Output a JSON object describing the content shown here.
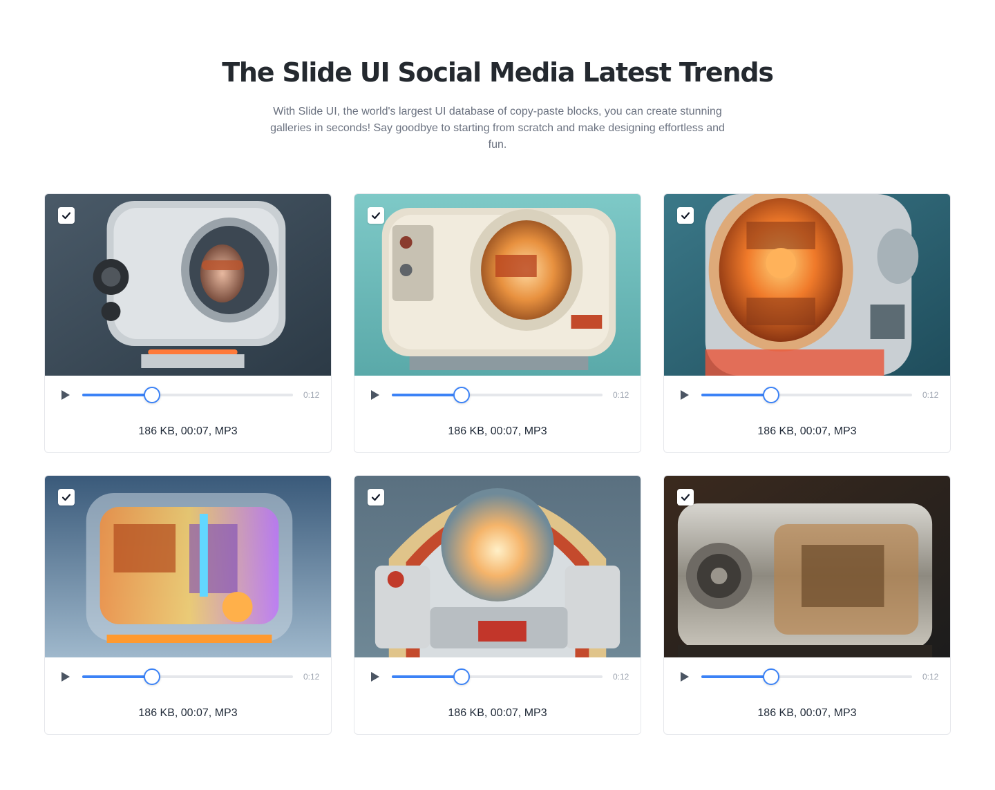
{
  "header": {
    "title": "The Slide UI Social Media Latest Trends",
    "description": "With Slide UI, the world's largest UI database of copy-paste blocks, you can create stunning galleries in seconds! Say goodbye to starting from scratch and make designing effortless and fun."
  },
  "colors": {
    "accent": "#3b82f6",
    "track": "#e5e7eb"
  },
  "cards": [
    {
      "meta": "186 KB, 00:07, MP3",
      "time": "0:12",
      "progress_pct": 33,
      "checked": true,
      "image": "retro-tv-with-face"
    },
    {
      "meta": "186 KB, 00:07, MP3",
      "time": "0:12",
      "progress_pct": 33,
      "checked": true,
      "image": "cream-retro-device"
    },
    {
      "meta": "186 KB, 00:07, MP3",
      "time": "0:12",
      "progress_pct": 33,
      "checked": true,
      "image": "orange-glass-machine"
    },
    {
      "meta": "186 KB, 00:07, MP3",
      "time": "0:12",
      "progress_pct": 33,
      "checked": true,
      "image": "transparent-neon-machine"
    },
    {
      "meta": "186 KB, 00:07, MP3",
      "time": "0:12",
      "progress_pct": 33,
      "checked": true,
      "image": "jukebox-dome"
    },
    {
      "meta": "186 KB, 00:07, MP3",
      "time": "0:12",
      "progress_pct": 33,
      "checked": true,
      "image": "chrome-glass-box"
    }
  ]
}
